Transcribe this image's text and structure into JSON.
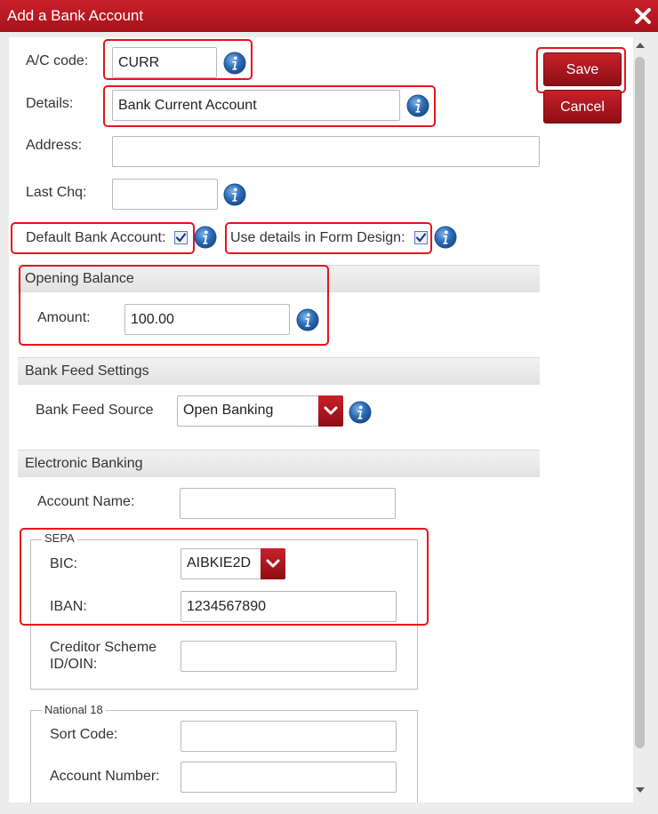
{
  "window": {
    "title": "Add a Bank Account"
  },
  "fields": {
    "ac_code": {
      "label": "A/C code:",
      "value": "CURR"
    },
    "details": {
      "label": "Details:",
      "value": "Bank Current Account"
    },
    "address": {
      "label": "Address:",
      "value": ""
    },
    "last_chq": {
      "label": "Last Chq:",
      "value": ""
    },
    "default_bank": {
      "label": "Default Bank Account:",
      "checked": true
    },
    "use_details": {
      "label": "Use details in Form Design:",
      "checked": true
    }
  },
  "buttons": {
    "save": "Save",
    "cancel": "Cancel"
  },
  "opening_balance": {
    "heading": "Opening Balance",
    "amount_label": "Amount:",
    "amount_value": "100.00"
  },
  "bank_feed": {
    "heading": "Bank Feed Settings",
    "source_label": "Bank Feed Source",
    "source_value": "Open Banking"
  },
  "electronic_banking": {
    "heading": "Electronic Banking",
    "account_name_label": "Account Name:",
    "account_name_value": "",
    "sepa": {
      "legend": "SEPA",
      "bic_label": "BIC:",
      "bic_value": "AIBKIE2D",
      "iban_label": "IBAN:",
      "iban_value": "1234567890",
      "creditor_label_1": "Creditor Scheme",
      "creditor_label_2": "ID/OIN:",
      "creditor_value": ""
    },
    "national": {
      "legend": "National 18",
      "sort_code_label": "Sort Code:",
      "sort_code_value": "",
      "account_number_label": "Account Number:",
      "account_number_value": ""
    }
  },
  "colors": {
    "brand_red": "#c8202a",
    "highlight_red": "#e5141d",
    "info_blue": "#2a6ab4"
  },
  "icons": {
    "info": "info-icon",
    "close": "close-icon",
    "dropdown": "chevron-down-icon",
    "checkbox": "checkmark-icon"
  }
}
